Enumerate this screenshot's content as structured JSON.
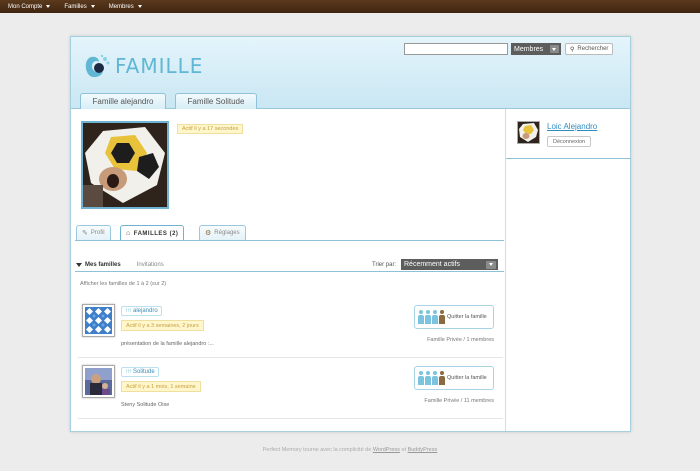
{
  "adminbar": {
    "items": [
      {
        "label": "Mon Compte"
      },
      {
        "label": "Familles"
      },
      {
        "label": "Membres"
      }
    ]
  },
  "header": {
    "logo_text": "FAMILLE",
    "search": {
      "placeholder": "",
      "scope": "Membres",
      "button": "Rechercher"
    },
    "tabs": [
      {
        "label": "Famille alejandro"
      },
      {
        "label": "Famille Solitude"
      }
    ]
  },
  "profile": {
    "active_text": "Actif il y a 17 secondes",
    "tabs": [
      {
        "label": "Profil"
      },
      {
        "label": "FAMILLES (2)"
      },
      {
        "label": "Réglages"
      }
    ]
  },
  "groups": {
    "subnav": {
      "mine": "Mes familles",
      "invitations": "Invitations"
    },
    "sort_label": "Trier par:",
    "sort_value": "Récemment actifs",
    "count_text": "Afficher les familles de 1 à 2 (sur 2)",
    "items": [
      {
        "name": "alejandro",
        "active": "Actif il y a 3 semaines, 2 jours",
        "desc": "présentation de la famille alejandro :...",
        "leave": "Quitter la famille",
        "meta": "Famille Privée / 1 membres"
      },
      {
        "name": "Solitude",
        "active": "Actif il y a 1 mois, 1 semaine",
        "desc": "Steny Solitude Oise",
        "leave": "Quitter la famille",
        "meta": "Famille Privée / 11 membres"
      }
    ]
  },
  "sidebar": {
    "user_name": "Loic Alejandro",
    "logout": "Déconnexion"
  },
  "footer": {
    "prefix": "Perfect Memory tourne avec la complicité de ",
    "link1": "WordPress",
    "middle": " et ",
    "link2": "BuddyPress"
  },
  "colors": {
    "accent": "#5fb6d5",
    "adminbar": "#4a2e16",
    "badge": "#fff6cc"
  }
}
